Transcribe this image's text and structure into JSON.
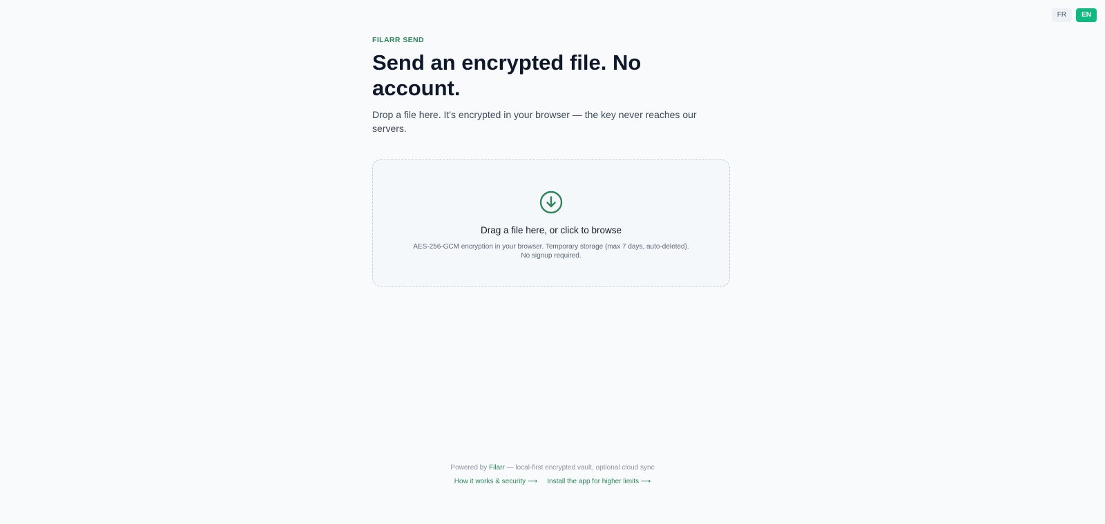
{
  "lang_switch": {
    "options": [
      "FR",
      "EN"
    ],
    "active": "EN"
  },
  "hero": {
    "eyebrow": "FILARR SEND",
    "headline": "Send an encrypted file. No account.",
    "subtitle": "Drop a file here. It's encrypted in your browser — the key never reaches our servers."
  },
  "dropzone": {
    "icon": "download-arrow-circle-icon",
    "title": "Drag a file here, or click to browse",
    "note_line1": "AES-256-GCM encryption in your browser. Temporary storage (max 7 days, auto-deleted).",
    "note_line2": "No signup required."
  },
  "footer": {
    "powered_prefix": "Powered by",
    "brand": "Filarr",
    "powered_suffix": "— local-first encrypted vault, optional cloud sync",
    "links": [
      "How it works & security ⟶",
      "Install the app for higher limits ⟶"
    ]
  },
  "colors": {
    "accent": "#10b981",
    "brand_green": "#2f855a",
    "background": "#f8fafc"
  }
}
